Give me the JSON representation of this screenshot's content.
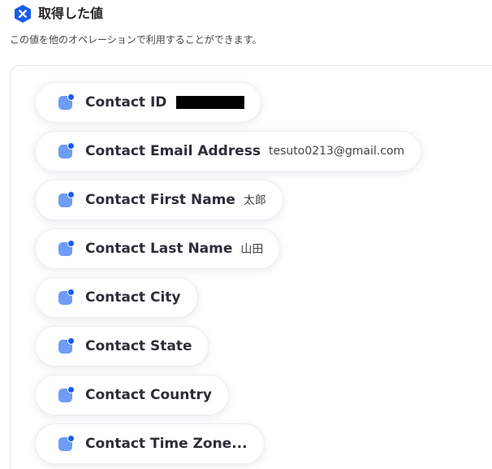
{
  "header": {
    "icon": "x-hexagon-icon",
    "title": "取得した値",
    "subtitle": "この値を他のオペレーションで利用することができます。"
  },
  "colors": {
    "accent": "#1a5bf0",
    "chip_icon": "#6f9cf5",
    "panel_border": "#e3e5ea"
  },
  "fields": [
    {
      "label": "Contact ID",
      "value": "",
      "redacted": true
    },
    {
      "label": "Contact Email Address",
      "value": "tesuto0213@gmail.com"
    },
    {
      "label": "Contact First Name",
      "value": "太郎"
    },
    {
      "label": "Contact Last Name",
      "value": "山田"
    },
    {
      "label": "Contact City",
      "value": ""
    },
    {
      "label": "Contact State",
      "value": ""
    },
    {
      "label": "Contact Country",
      "value": ""
    },
    {
      "label": "Contact Time Zone...",
      "value": ""
    }
  ]
}
